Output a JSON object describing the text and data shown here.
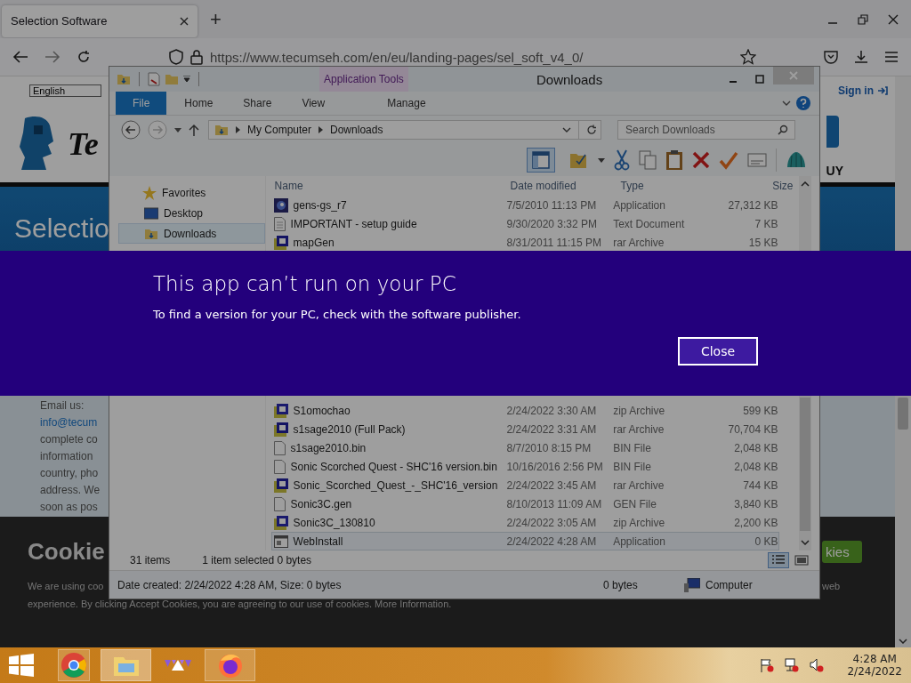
{
  "browser": {
    "tab": {
      "title": "Selection Software",
      "selected": true
    },
    "new_tab": "+",
    "url": "https://www.tecumseh.com/en/eu/landing-pages/sel_soft_v4_0/"
  },
  "website": {
    "language": "English",
    "sign_in": "Sign in",
    "logo_text": "Te",
    "header_text": "UY",
    "banner_title": "Selectio",
    "email_lines": [
      {
        "kind": "text",
        "text": "Email us:"
      },
      {
        "kind": "link",
        "text": "info@tecum"
      },
      {
        "kind": "text",
        "text": "complete co"
      },
      {
        "kind": "text",
        "text": "information"
      },
      {
        "kind": "text",
        "text": "country, pho"
      },
      {
        "kind": "text",
        "text": "address. We"
      },
      {
        "kind": "text",
        "text": "soon as pos"
      }
    ],
    "cookie_title": "Cookie",
    "cookie_lines": [
      "We are using coo",
      "experience. By clicking Accept Cookies, you are agreeing to our use of cookies.  More Information."
    ],
    "cookie_button": "kies",
    "cookie_side_text": "web"
  },
  "explorer": {
    "title": "Downloads",
    "context_tab": "Application Tools",
    "ribbon_tabs": [
      {
        "label": "File",
        "kind": "file",
        "selected": false
      },
      {
        "label": "Home",
        "kind": "tab",
        "selected": false
      },
      {
        "label": "Share",
        "kind": "tab",
        "selected": false
      },
      {
        "label": "View",
        "kind": "tab",
        "selected": false
      },
      {
        "label": "Manage",
        "kind": "context",
        "selected": false
      }
    ],
    "breadcrumb": [
      "My Computer",
      "Downloads"
    ],
    "search_placeholder": "Search Downloads",
    "nav": [
      {
        "label": "Favorites",
        "kind": "star",
        "selected": false,
        "children": [
          {
            "label": "Desktop",
            "kind": "desktop",
            "selected": false
          },
          {
            "label": "Downloads",
            "kind": "downloads",
            "selected": true
          }
        ]
      }
    ],
    "columns": [
      "Name",
      "Date modified",
      "Type",
      "Size"
    ],
    "row_groups": [
      [
        {
          "name": "gens-gs_r7",
          "date": "7/5/2010 11:13 PM",
          "type": "Application",
          "size": "27,312 KB",
          "kind": "app",
          "selected": false
        },
        {
          "name": "IMPORTANT - setup guide",
          "date": "9/30/2020 3:32 PM",
          "type": "Text Document",
          "size": "7 KB",
          "kind": "text",
          "selected": false
        },
        {
          "name": "mapGen",
          "date": "8/31/2011 11:15 PM",
          "type": "rar Archive",
          "size": "15 KB",
          "kind": "rar",
          "selected": false
        }
      ],
      [
        {
          "name": "S1omochao",
          "date": "2/24/2022 3:30 AM",
          "type": "zip Archive",
          "size": "599 KB",
          "kind": "zip",
          "selected": false
        },
        {
          "name": "s1sage2010 (Full Pack)",
          "date": "2/24/2022 3:31 AM",
          "type": "rar Archive",
          "size": "70,704 KB",
          "kind": "rar",
          "selected": false
        },
        {
          "name": "s1sage2010.bin",
          "date": "8/7/2010 8:15 PM",
          "type": "BIN File",
          "size": "2,048 KB",
          "kind": "file",
          "selected": false
        },
        {
          "name": "Sonic Scorched Quest - SHC'16 version.bin",
          "date": "10/16/2016 2:56 PM",
          "type": "BIN File",
          "size": "2,048 KB",
          "kind": "file",
          "selected": false
        },
        {
          "name": "Sonic_Scorched_Quest_-_SHC'16_version",
          "date": "2/24/2022 3:45 AM",
          "type": "rar Archive",
          "size": "744 KB",
          "kind": "rar",
          "selected": false
        },
        {
          "name": "Sonic3C.gen",
          "date": "8/10/2013 11:09 AM",
          "type": "GEN File",
          "size": "3,840 KB",
          "kind": "file",
          "selected": false
        },
        {
          "name": "Sonic3C_130810",
          "date": "2/24/2022 3:05 AM",
          "type": "zip Archive",
          "size": "2,200 KB",
          "kind": "zip",
          "selected": false
        },
        {
          "name": "WebInstall",
          "date": "2/24/2022 4:28 AM",
          "type": "Application",
          "size": "0 KB",
          "kind": "window",
          "selected": true
        }
      ]
    ],
    "status": {
      "count": "31 items",
      "selection": "1 item selected  0 bytes"
    },
    "details": {
      "created": "Date created: 2/24/2022 4:28 AM, Size: 0 bytes",
      "size": "0 bytes",
      "location": "Computer"
    }
  },
  "dialog": {
    "title": "This app can’t run on your PC",
    "message": "To find a version for your PC, check with the software publisher.",
    "button": "Close"
  },
  "taskbar": {
    "apps": [
      {
        "kind": "chrome",
        "running": true,
        "selected": false
      },
      {
        "kind": "explorer",
        "running": true,
        "selected": true
      },
      {
        "kind": "triangles",
        "running": false,
        "selected": false
      },
      {
        "kind": "firefox",
        "running": true,
        "selected": false
      }
    ],
    "time": "4:28 AM",
    "date": "2/24/2022"
  }
}
